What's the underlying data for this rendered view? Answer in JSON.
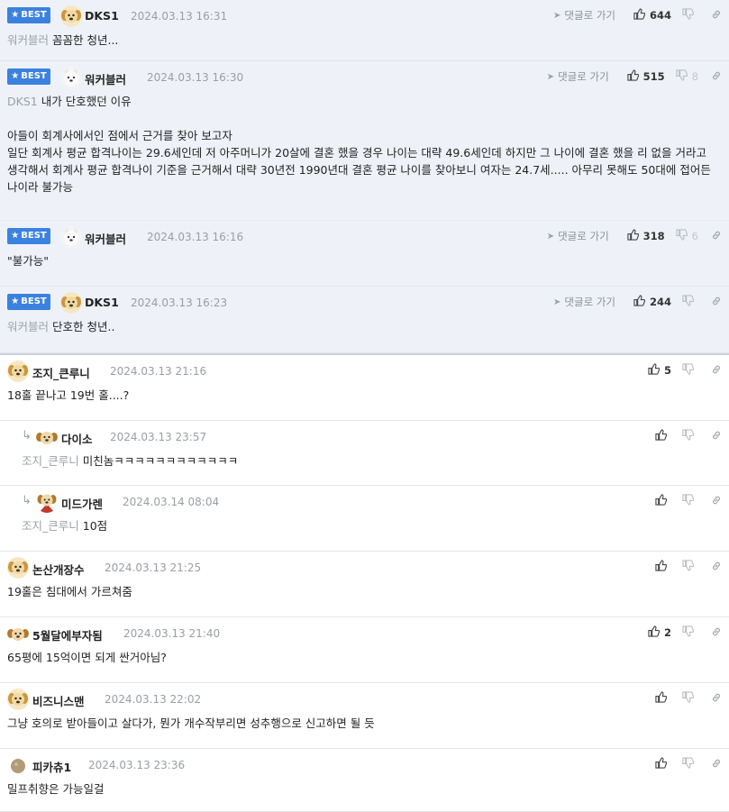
{
  "actions": {
    "reply_label": "댓글로 가기"
  },
  "comments": [
    {
      "best": true,
      "badge": "BEST",
      "nick": "DKS1",
      "date": "2024.03.13 16:31",
      "likes": "644",
      "dislikes": "",
      "mention": "워커블러",
      "lines": [
        "꼼꼼한 청년..."
      ],
      "avatar": "dog-icon"
    },
    {
      "best": true,
      "badge": "BEST",
      "nick": "워커블러",
      "date": "2024.03.13 16:30",
      "likes": "515",
      "dislikes": "8",
      "mention": "DKS1",
      "lines": [
        "내가 단호했던 이유",
        "",
        "아들이 회계사에서인 점에서 근거를 찾아 보고자",
        "일단 회계사 평균 합격나이는 29.6세인데 저 아주머니가 20살에 결혼 했을 경우 나이는 대략 49.6세인데 하지만 그 나이에 결혼 했을 리 없을 거라고 생각해서 회계사 평균 합격나이 기준을 근거해서 대략 30년전 1990년대 결혼 평균 나이를 찾아보니 여자는 24.7세..... 아무리 못해도 50대에 접어든 나이라 불가능"
      ],
      "avatar": "samoyed-icon"
    },
    {
      "best": true,
      "badge": "BEST",
      "nick": "워커블러",
      "date": "2024.03.13 16:16",
      "likes": "318",
      "dislikes": "6",
      "mention": "",
      "lines": [
        "\"불가능\""
      ],
      "avatar": "samoyed-icon"
    },
    {
      "best": true,
      "badge": "BEST",
      "nick": "DKS1",
      "date": "2024.03.13 16:23",
      "likes": "244",
      "dislikes": "",
      "mention": "워커블러",
      "lines": [
        "단호한 청년.."
      ],
      "avatar": "dog-icon"
    },
    {
      "best": false,
      "nick": "조지_큰루니",
      "date": "2024.03.13 21:16",
      "likes": "5",
      "dislikes": "",
      "mention": "",
      "lines": [
        "18홀 끝나고 19번 홀....?"
      ],
      "avatar": "dog-icon"
    },
    {
      "best": false,
      "reply": true,
      "nick": "다이소",
      "date": "2024.03.13 23:57",
      "likes": "",
      "dislikes": "",
      "mention": "조지_큰루니",
      "lines": [
        "미친놈ㅋㅋㅋㅋㅋㅋㅋㅋㅋㅋㅋㅋ"
      ],
      "avatar": "dog-face-icon"
    },
    {
      "best": false,
      "reply": true,
      "nick": "미드가렌",
      "date": "2024.03.14 08:04",
      "likes": "",
      "dislikes": "",
      "mention": "조지_큰루니",
      "lines": [
        "10점"
      ],
      "avatar": "dog-cape-icon"
    },
    {
      "best": false,
      "nick": "논산개장수",
      "date": "2024.03.13 21:25",
      "likes": "",
      "dislikes": "",
      "mention": "",
      "lines": [
        "19홀은 침대에서 가르쳐줌"
      ],
      "avatar": "dog-icon"
    },
    {
      "best": false,
      "nick": "5월달에부자됨",
      "date": "2024.03.13 21:40",
      "likes": "2",
      "dislikes": "",
      "mention": "",
      "lines": [
        "65평에 15억이면 되게 싼거아님?"
      ],
      "avatar": "dog-face-icon"
    },
    {
      "best": false,
      "nick": "비즈니스맨",
      "date": "2024.03.13 22:02",
      "likes": "",
      "dislikes": "",
      "mention": "",
      "lines": [
        "그냥 호의로 받아들이고 살다가, 뭔가 개수작부리면 성추행으로 신고하면 될 듯"
      ],
      "avatar": "dog-icon"
    },
    {
      "best": false,
      "nick": "피카츄1",
      "date": "2024.03.13 23:36",
      "likes": "",
      "dislikes": "",
      "mention": "",
      "lines": [
        "밀프취향은 가능일걸"
      ],
      "avatar": "ball-icon"
    }
  ]
}
